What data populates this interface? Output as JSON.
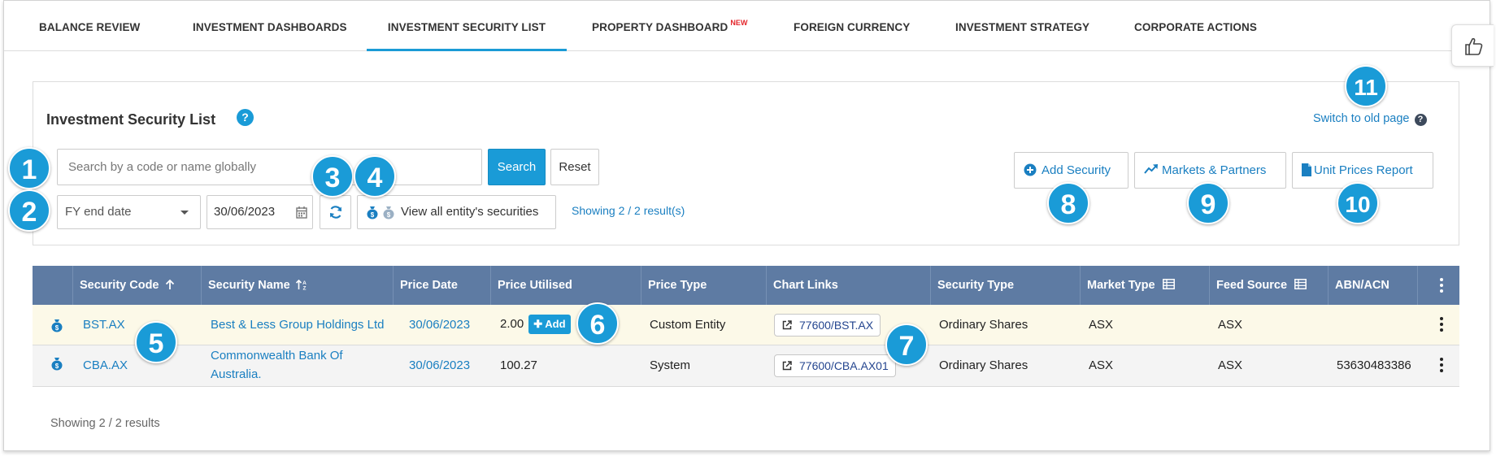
{
  "tabs": [
    {
      "label": "BALANCE REVIEW"
    },
    {
      "label": "INVESTMENT DASHBOARDS"
    },
    {
      "label": "INVESTMENT SECURITY LIST"
    },
    {
      "label": "PROPERTY DASHBOARD"
    },
    {
      "label": "FOREIGN CURRENCY"
    },
    {
      "label": "INVESTMENT STRATEGY"
    },
    {
      "label": "CORPORATE ACTIONS"
    }
  ],
  "tab_new_badge": "NEW",
  "active_tab": "INVESTMENT SECURITY LIST",
  "panel": {
    "title": "Investment Security List",
    "help": "?",
    "search": {
      "placeholder": "Search by a code or name globally",
      "value": ""
    },
    "search_button": "Search",
    "reset_button": "Reset",
    "date_filter": "FY end date",
    "date_value": "30/06/2023",
    "view_all": "View all entity's securities",
    "showing_top": "Showing 2 / 2 result(s)",
    "switch_old": "Switch to old page",
    "switch_help": "?",
    "actions": {
      "add_security": "Add Security",
      "markets": "Markets & Partners",
      "unit_prices": "Unit Prices Report"
    }
  },
  "table": {
    "headers": [
      "Security Code",
      "Security Name",
      "Price Date",
      "Price Utilised",
      "Price Type",
      "Chart Links",
      "Security Type",
      "Market Type",
      "Feed Source",
      "ABN/ACN"
    ],
    "rows": [
      {
        "code": "BST.AX",
        "name": "Best & Less Group Holdings Ltd",
        "name2": "",
        "date": "30/06/2023",
        "price": "2.00",
        "add": "Add",
        "price_type": "Custom Entity",
        "chart": "77600/BST.AX",
        "sec_type": "Ordinary Shares",
        "market": "ASX",
        "feed": "ASX",
        "abn": ""
      },
      {
        "code": "CBA.AX",
        "name": "Commonwealth Bank Of",
        "name2": "Australia.",
        "date": "30/06/2023",
        "price": "100.27",
        "add": "",
        "price_type": "System",
        "chart": "77600/CBA.AX01",
        "sec_type": "Ordinary Shares",
        "market": "ASX",
        "feed": "ASX",
        "abn": "53630483386"
      }
    ]
  },
  "showing_bottom": "Showing 2 / 2 results",
  "callouts": [
    "1",
    "2",
    "3",
    "4",
    "5",
    "6",
    "7",
    "8",
    "9",
    "10",
    "11"
  ],
  "colors": {
    "accent": "#1a9bd7",
    "header": "#5e7ba3",
    "link": "#1a7fc1",
    "highlight_row": "#fcf9e8"
  }
}
